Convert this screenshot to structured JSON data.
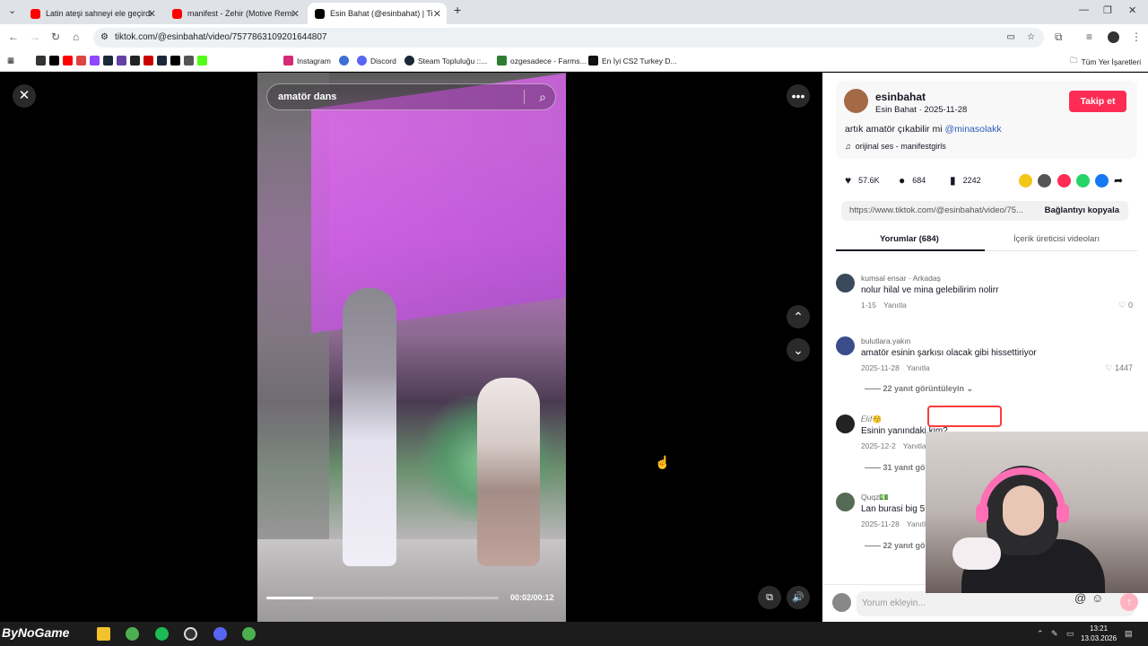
{
  "browser": {
    "tabs": [
      {
        "title": "Latin ateşi sahneyi ele geçirdi❤️",
        "icon": "youtube-icon",
        "color": "#ff0000"
      },
      {
        "title": "manifest - Zehir (Motive Remix",
        "icon": "youtube-icon",
        "color": "#ff0000"
      },
      {
        "title": "Esin Bahat (@esinbahat) | Ti",
        "icon": "tiktok-icon",
        "color": "#000000"
      }
    ],
    "url": "tiktok.com/@esinbahat/video/7577863109201644807",
    "bookmarks": [
      "Instagram",
      "Discord",
      "Steam Topluluğu ::...",
      "ozgesadece - Farms...",
      "En İyi CS2 Turkey D..."
    ],
    "all_bookmarks": "Tüm Yer İşaretleri"
  },
  "video": {
    "search_text": "amatör dans",
    "time": "00:02/00:12",
    "progress": 0.2
  },
  "post": {
    "username": "esinbahat",
    "display_name": "Esin Bahat",
    "date": "2025-11-28",
    "follow_label": "Takip et",
    "caption": "artık amatör çıkabilir mi ",
    "mention": "@minasolakk",
    "music": "orijinal ses - manifestgirls",
    "likes": "57.6K",
    "comments": "684",
    "saves": "2242",
    "link": "https://www.tiktok.com/@esinbahat/video/75...",
    "copy_label": "Bağlantıyı kopyala",
    "tab_comments": "Yorumlar (684)",
    "tab_creator": "İçerik üreticisi videoları"
  },
  "comments": [
    {
      "user": "kumsal ensar · Arkadaş",
      "text": "nolur hilal ve mina gelebilirim nolirr",
      "date": "1-15",
      "likes": "0"
    },
    {
      "user": "bulutlara.yakın",
      "text": "amatör esinin şarkısı olacak gibi hissettiriyor",
      "date": "2025-11-28",
      "likes": "1447",
      "more": "22 yanıt görüntüleyin"
    },
    {
      "user": "𝐸𝑙𝑖𝑓😚",
      "text": "Esinin yanındaki kim?",
      "date": "2025-12-2",
      "more": "31 yanıt gö"
    },
    {
      "user": "Quqz💵",
      "text": "Lan burasi big 5",
      "date": "2025-11-28",
      "more": "22 yanıt gö"
    }
  ],
  "reply_label": "Yanıtla",
  "composer_placeholder": "Yorum ekleyin...",
  "taskbar": {
    "time": "13:21",
    "date": "13.03.2026",
    "logo": "ByNoGame"
  }
}
